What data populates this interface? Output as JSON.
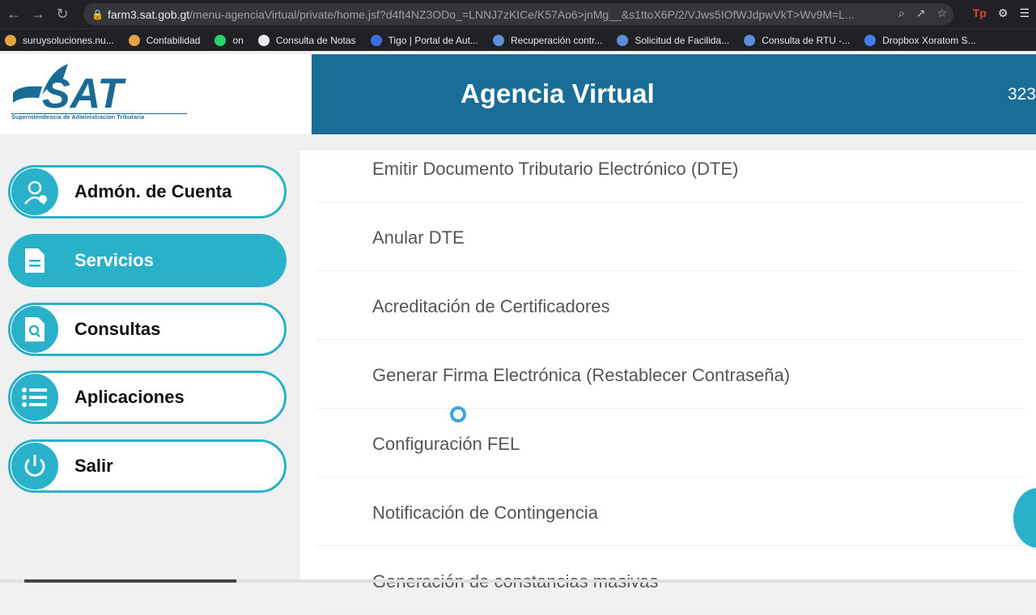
{
  "browser": {
    "url_host": "farm3.sat.gob.gt",
    "url_path": "/menu-agenciaVirtual/private/home.jsf?d4ft4NZ3ODo_=LNNJ7zKICe/K57Ao6>jnMg__&s1ttoX6P/2/VJws5IOfWJdpwVkT>Wv9M=L...",
    "extension_tp": "Tp",
    "bookmarks": [
      {
        "label": "suruysoluciones.nu...",
        "color": "#e8a33d"
      },
      {
        "label": "Contabilidad",
        "color": "#e8a33d"
      },
      {
        "label": "on",
        "color": "#25d366"
      },
      {
        "label": "Consulta de Notas",
        "color": "#e8eaed"
      },
      {
        "label": "Tigo | Portal de Aut...",
        "color": "#3c6ee0"
      },
      {
        "label": "Recuperación contr...",
        "color": "#5a8ed8"
      },
      {
        "label": "Solicitud de Facilida...",
        "color": "#5a8ed8"
      },
      {
        "label": "Consulta de RTU -...",
        "color": "#5a8ed8"
      },
      {
        "label": "Dropbox Xoratom S...",
        "color": "#3d7ff0"
      }
    ]
  },
  "header": {
    "logo_text": "SAT",
    "logo_subtitle": "Superintendencia de Administracion Tributaria",
    "title": "Agencia Virtual",
    "number": "323"
  },
  "sidebar": {
    "items": [
      {
        "label": "Admón. de Cuenta",
        "icon": "user-gear-icon",
        "active": false
      },
      {
        "label": "Servicios",
        "icon": "document-icon",
        "active": true
      },
      {
        "label": "Consultas",
        "icon": "search-document-icon",
        "active": false
      },
      {
        "label": "Aplicaciones",
        "icon": "list-icon",
        "active": false
      },
      {
        "label": "Salir",
        "icon": "power-icon",
        "active": false
      }
    ]
  },
  "services": [
    "Emitir Documento Tributario Electrónico (DTE)",
    "Anular DTE",
    "Acreditación de Certificadores",
    "Generar Firma Electrónica (Restablecer Contraseña)",
    "Configuración FEL",
    "Notificación de Contingencia",
    "Generación de constancias masivas"
  ],
  "colors": {
    "header": "#1a6d97",
    "accent": "#29b1c9"
  }
}
